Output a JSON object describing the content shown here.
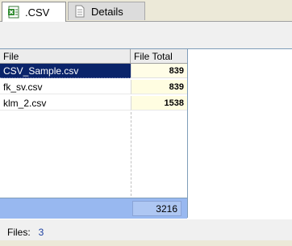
{
  "tabs": [
    {
      "label": ".CSV",
      "icon": "excel-csv-icon"
    },
    {
      "label": "Details",
      "icon": "document-icon"
    }
  ],
  "grid": {
    "columns": [
      "File",
      "File Total"
    ],
    "rows": [
      {
        "file": "CSV_Sample.csv",
        "total": "839"
      },
      {
        "file": "fk_sv.csv",
        "total": "839"
      },
      {
        "file": "klm_2.csv",
        "total": "1538"
      }
    ],
    "footer_total": "3216"
  },
  "status": {
    "label": "Files:",
    "value": "3"
  },
  "colors": {
    "selection": "#0a246a",
    "footer": "#98b8f0",
    "total_cell": "#fffde1"
  }
}
